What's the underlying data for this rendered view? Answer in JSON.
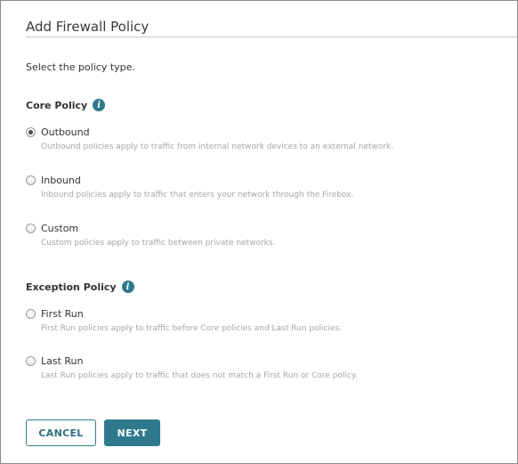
{
  "page": {
    "title": "Add Firewall Policy",
    "intro": "Select the policy type."
  },
  "core": {
    "heading": "Core Policy",
    "info_glyph": "i",
    "options": [
      {
        "label": "Outbound",
        "description": "Outbound policies apply to traffic from internal network devices to an external network.",
        "selected": true
      },
      {
        "label": "Inbound",
        "description": "Inbound policies apply to traffic that enters your network through the Firebox.",
        "selected": false
      },
      {
        "label": "Custom",
        "description": "Custom policies apply to traffic between private networks.",
        "selected": false
      }
    ]
  },
  "exception": {
    "heading": "Exception Policy",
    "info_glyph": "i",
    "options": [
      {
        "label": "First Run",
        "description": "First Run policies apply to traffic before Core policies and Last Run policies.",
        "selected": false
      },
      {
        "label": "Last Run",
        "description": "Last Run policies apply to traffic that does not match a First Run or Core policy.",
        "selected": false
      }
    ]
  },
  "buttons": {
    "cancel": "CANCEL",
    "next": "NEXT"
  },
  "colors": {
    "accent": "#2e7a8c",
    "description_text": "#a6a6a6",
    "border": "#8c8c8c"
  }
}
